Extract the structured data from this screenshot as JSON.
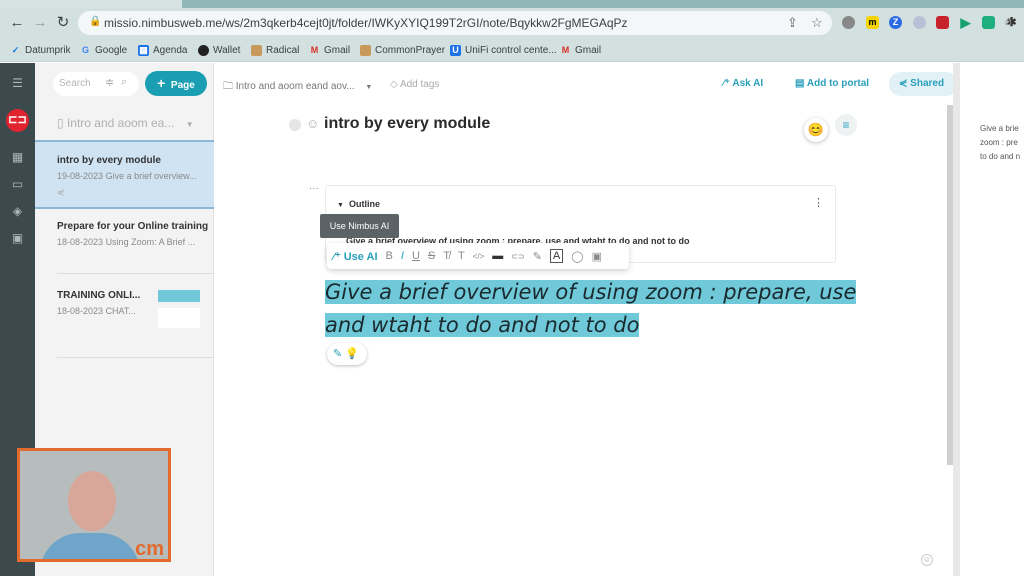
{
  "browser": {
    "url": "missio.nimbusweb.me/ws/2m3qkerb4cejt0jt/folder/IWKyXYIQ199T2rGI/note/Bqykkw2FgMEGAqPz",
    "bookmarks": [
      {
        "label": "Datumprik",
        "icon": "check-icon",
        "color": "#1a73e8"
      },
      {
        "label": "Google",
        "icon": "google-icon",
        "color": "#4285f4"
      },
      {
        "label": "Agenda",
        "icon": "calendar-icon",
        "color": "#1a73e8"
      },
      {
        "label": "Wallet",
        "icon": "globe-icon",
        "color": "#222222"
      },
      {
        "label": "Radical",
        "icon": "bookmark-icon",
        "color": "#c79a5c"
      },
      {
        "label": "Gmail",
        "icon": "gmail-icon",
        "color": "#d93025"
      },
      {
        "label": "CommonPrayer",
        "icon": "bookmark-icon",
        "color": "#c79a5c"
      },
      {
        "label": "UniFi  control cente...",
        "icon": "unifi-icon",
        "color": "#1a73e8"
      },
      {
        "label": "Gmail",
        "icon": "gmail-icon",
        "color": "#d93025"
      }
    ]
  },
  "sidebar": {
    "search_placeholder": "Search",
    "new_page_label": "Page",
    "folder_name": "Intro and aoom ea...",
    "notes": [
      {
        "title": "intro by every module",
        "date": "19-08-2023",
        "snippet": "Give a brief overview...",
        "selected": true
      },
      {
        "title": "Prepare for your Online training",
        "date": "18-08-2023",
        "snippet": "Using Zoom: A Brief ...",
        "selected": false
      },
      {
        "title": "TRAINING ONLI...",
        "date": "18-08-2023",
        "snippet": "CHAT...",
        "selected": false
      }
    ]
  },
  "header": {
    "breadcrumb": "Intro and aoom eand aov...",
    "add_tags": "Add tags",
    "ask_ai": "Ask AI",
    "add_to_portal": "Add to portal",
    "shared": "Shared"
  },
  "note": {
    "title": "intro by every module",
    "outline_label": "Outline",
    "outline_item": "Give a brief overview of using zoom : prepare, use and wtaht to do and not to do",
    "tooltip": "Use Nimbus AI",
    "toolbar": {
      "use_ai": "Use AI",
      "buttons": [
        "B",
        "I",
        "U",
        "S",
        "T̸",
        "T",
        "</>",
        "▬",
        "⊂⊃",
        "✎",
        "A",
        "◯",
        "▣"
      ]
    },
    "selected_text_line1": "Give a brief overview of using zoom : prepare, use",
    "selected_text_line2": "and wtaht to do and not to do",
    "accent_color": "#2a9fbb",
    "highlight_color": "#6fc9d9"
  },
  "right_panel": {
    "preview_lines": [
      "Give a brie",
      "zoom : pre",
      "to do and n"
    ]
  },
  "video": {
    "watermark": "cm"
  }
}
